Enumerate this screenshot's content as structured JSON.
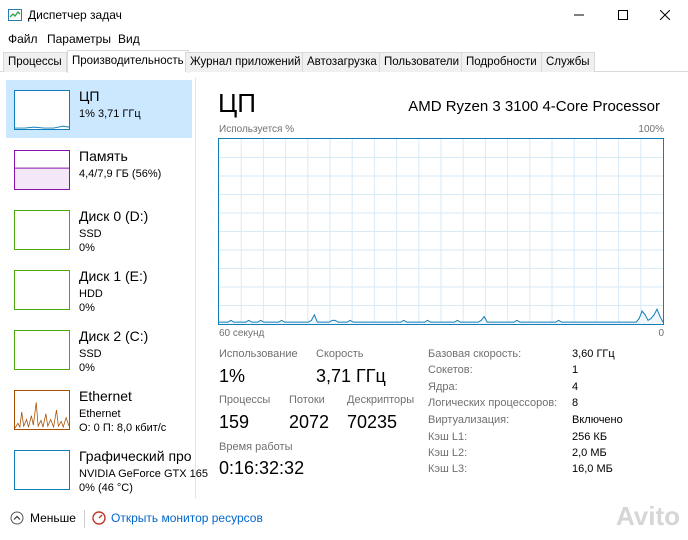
{
  "window": {
    "title": "Диспетчер задач"
  },
  "menu": [
    "Файл",
    "Параметры",
    "Вид"
  ],
  "tabs": [
    "Процессы",
    "Производительность",
    "Журнал приложений",
    "Автозагрузка",
    "Пользователи",
    "Подробности",
    "Службы"
  ],
  "active_tab": "Производительность",
  "sidebar": {
    "items": [
      {
        "title": "ЦП",
        "sub1": "1% 3,71 ГГц",
        "sub2": "",
        "sub3": "",
        "color": "#117dbb"
      },
      {
        "title": "Память",
        "sub1": "4,4/7,9 ГБ (56%)",
        "sub2": "",
        "sub3": "",
        "color": "#8b12ae"
      },
      {
        "title": "Диск 0 (D:)",
        "sub1": "SSD",
        "sub2": "0%",
        "sub3": "",
        "color": "#4da60c"
      },
      {
        "title": "Диск 1 (E:)",
        "sub1": "HDD",
        "sub2": "0%",
        "sub3": "",
        "color": "#4da60c"
      },
      {
        "title": "Диск 2 (C:)",
        "sub1": "SSD",
        "sub2": "0%",
        "sub3": "",
        "color": "#4da60c"
      },
      {
        "title": "Ethernet",
        "sub1": "Ethernet",
        "sub2": "О: 0 П: 8,0 кбит/с",
        "sub3": "",
        "color": "#a74f01"
      },
      {
        "title": "Графический про",
        "sub1": "NVIDIA GeForce GTX 165",
        "sub2": "0% (46 °C)",
        "sub3": "",
        "color": "#117dbb"
      }
    ]
  },
  "main": {
    "title": "ЦП",
    "cpu_model": "AMD Ryzen 3 3100 4-Core Processor",
    "graph_label_left": "Используется %",
    "graph_label_right": "100%",
    "graph_time_left": "60 секунд",
    "graph_time_right": "0",
    "graph_series": [
      1,
      1,
      1,
      1,
      2,
      1,
      1,
      1,
      1,
      1,
      2,
      1,
      1,
      1,
      2,
      1,
      1,
      1,
      1,
      1,
      1,
      2,
      1,
      1,
      1,
      1,
      1,
      1,
      1,
      1,
      1,
      2,
      5,
      1,
      1,
      1,
      1,
      1,
      2,
      2,
      1,
      1,
      1,
      1,
      2,
      1,
      1,
      1,
      1,
      1,
      1,
      1,
      1,
      1,
      1,
      1,
      1,
      1,
      1,
      1,
      1,
      1,
      2,
      1,
      1,
      1,
      1,
      1,
      1,
      1,
      2,
      1,
      1,
      1,
      1,
      1,
      1,
      1,
      1,
      1,
      2,
      1,
      1,
      1,
      1,
      1,
      1,
      1,
      2,
      4,
      1,
      1,
      1,
      1,
      1,
      1,
      1,
      1,
      1,
      1,
      2,
      1,
      1,
      1,
      1,
      1,
      1,
      1,
      1,
      1,
      1,
      1,
      1,
      1,
      2,
      1,
      1,
      1,
      1,
      1,
      1,
      1,
      1,
      1,
      1,
      1,
      1,
      1,
      1,
      1,
      1,
      1,
      1,
      1,
      1,
      1,
      1,
      1,
      1,
      1,
      1,
      3,
      7,
      5,
      2,
      3,
      5,
      8,
      4,
      1
    ],
    "stats": {
      "usage_label": "Использование",
      "usage_value": "1%",
      "speed_label": "Скорость",
      "speed_value": "3,71 ГГц",
      "processes_label": "Процессы",
      "processes_value": "159",
      "threads_label": "Потоки",
      "threads_value": "2072",
      "handles_label": "Дескрипторы",
      "handles_value": "70235",
      "uptime_label": "Время работы",
      "uptime_value": "0:16:32:32"
    },
    "specs": [
      {
        "label": "Базовая скорость:",
        "value": "3,60 ГГц"
      },
      {
        "label": "Сокетов:",
        "value": "1"
      },
      {
        "label": "Ядра:",
        "value": "4"
      },
      {
        "label": "Логических процессоров:",
        "value": "8"
      },
      {
        "label": "Виртуализация:",
        "value": "Включено"
      },
      {
        "label": "Кэш L1:",
        "value": "256 КБ"
      },
      {
        "label": "Кэш L2:",
        "value": "2,0 МБ"
      },
      {
        "label": "Кэш L3:",
        "value": "16,0 МБ"
      }
    ]
  },
  "footer": {
    "less_label": "Меньше",
    "monitor_link": "Открыть монитор ресурсов"
  },
  "watermark": "Avito"
}
